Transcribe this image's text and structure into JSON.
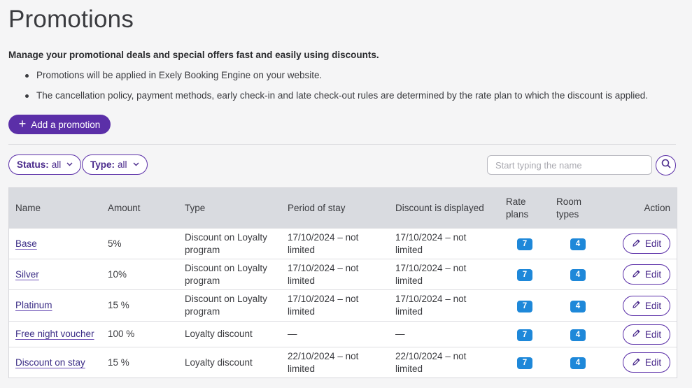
{
  "header": {
    "title": "Promotions"
  },
  "intro": {
    "text": "Manage your promotional deals and special offers fast and easily using discounts.",
    "bullets": [
      "Promotions will be applied in Exely Booking Engine on your website.",
      "The cancellation policy, payment methods, early check-in and late check-out rules are determined by the rate plan to which the discount is applied."
    ]
  },
  "toolbar": {
    "add_label": "Add a promotion",
    "add_icon": "plus-icon"
  },
  "filters": {
    "status": {
      "label": "Status:",
      "value": "all"
    },
    "type": {
      "label": "Type:",
      "value": "all"
    }
  },
  "search": {
    "placeholder": "Start typing the name",
    "icon": "search-icon"
  },
  "table": {
    "headers": {
      "name": "Name",
      "amount": "Amount",
      "type": "Type",
      "period": "Period of stay",
      "displayed": "Discount is displayed",
      "rate_plans_1": "Rate",
      "rate_plans_2": "plans",
      "room_types_1": "Room",
      "room_types_2": "types",
      "action": "Action"
    },
    "rows": [
      {
        "name": "Base",
        "amount": "5%",
        "type_1": "Discount on Loyalty",
        "type_2": "program",
        "period_1": "17/10/2024 – not",
        "period_2": "limited",
        "displayed_1": "17/10/2024 – not",
        "displayed_2": "limited",
        "rate_plans": "7",
        "room_types": "4",
        "edit": "Edit"
      },
      {
        "name": "Silver",
        "amount": "10%",
        "type_1": "Discount on Loyalty",
        "type_2": "program",
        "period_1": "17/10/2024 – not",
        "period_2": "limited",
        "displayed_1": "17/10/2024 – not",
        "displayed_2": "limited",
        "rate_plans": "7",
        "room_types": "4",
        "edit": "Edit"
      },
      {
        "name": "Platinum",
        "amount": "15 %",
        "type_1": "Discount on Loyalty",
        "type_2": "program",
        "period_1": "17/10/2024 – not",
        "period_2": "limited",
        "displayed_1": "17/10/2024 – not",
        "displayed_2": "limited",
        "rate_plans": "7",
        "room_types": "4",
        "edit": "Edit"
      },
      {
        "name": "Free night voucher",
        "amount": "100 %",
        "type_1": "Loyalty discount",
        "type_2": "",
        "period_1": "—",
        "period_2": "",
        "displayed_1": "—",
        "displayed_2": "",
        "rate_plans": "7",
        "room_types": "4",
        "edit": "Edit"
      },
      {
        "name": "Discount on stay",
        "amount": "15 %",
        "type_1": "Loyalty discount",
        "type_2": "",
        "period_1": "22/10/2024 – not",
        "period_2": "limited",
        "displayed_1": "22/10/2024 – not",
        "displayed_2": "limited",
        "rate_plans": "7",
        "room_types": "4",
        "edit": "Edit"
      }
    ]
  },
  "colors": {
    "accent": "#5b2fa8",
    "badge": "#1e88d9",
    "header_bg": "#d9dbe0",
    "page_bg": "#f5f5f6"
  }
}
